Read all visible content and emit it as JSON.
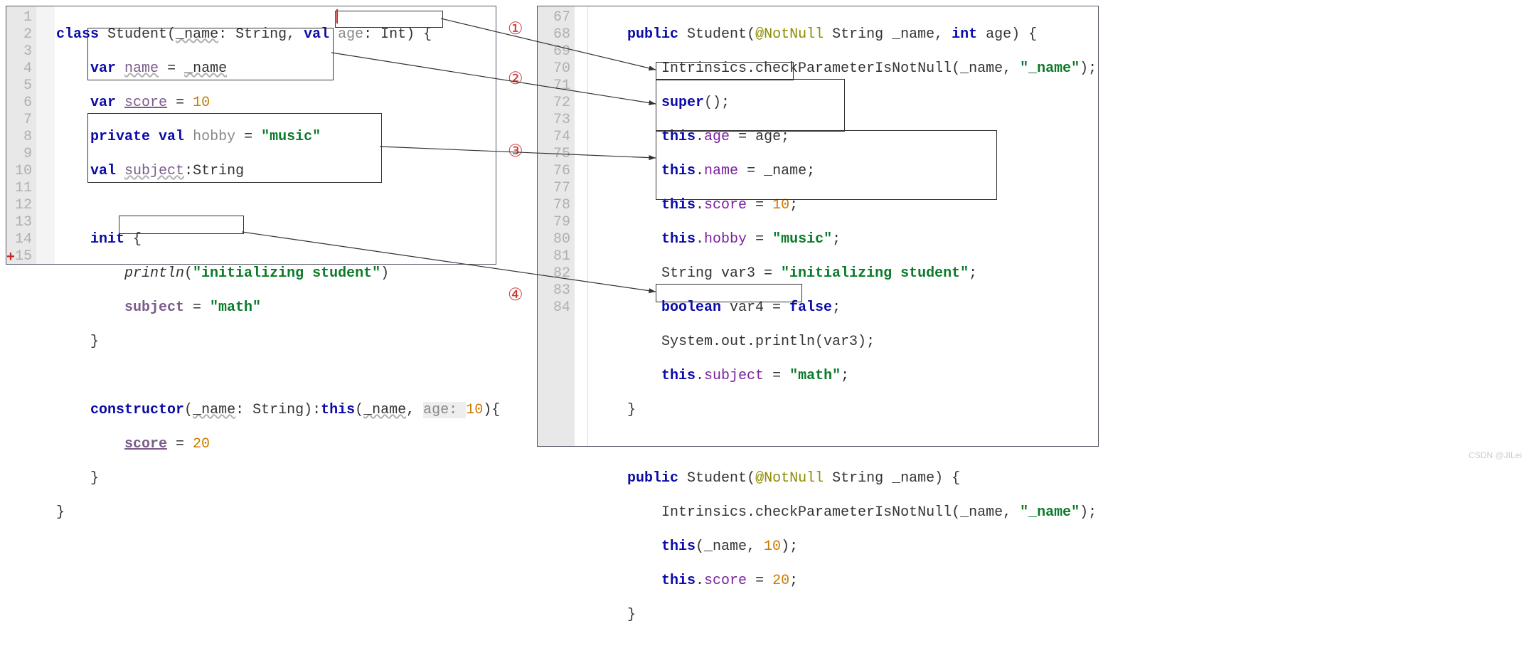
{
  "left": {
    "lines": [
      "1",
      "2",
      "3",
      "4",
      "5",
      "6",
      "7",
      "8",
      "9",
      "10",
      "11",
      "12",
      "13",
      "14",
      "15"
    ],
    "l1": {
      "kw1": "class",
      "name": "Student",
      "p": "(",
      "u": "_name",
      "t1": ": String, ",
      "kw2": "val",
      "sp": " ",
      "age": "age",
      "t2": ": Int) {"
    },
    "l2": {
      "kw": "var",
      "sp": " ",
      "name": "name",
      "eq": " = ",
      "u": "_name"
    },
    "l3": {
      "kw": "var",
      "sp": " ",
      "score": "score",
      "eq": " = ",
      "num": "10"
    },
    "l4": {
      "kw": "private val",
      "sp": " ",
      "hobby": "hobby",
      "eq": " = ",
      "str": "\"music\""
    },
    "l5": {
      "kw": "val",
      "sp": " ",
      "subj": "subject",
      "t": ":String"
    },
    "l7": {
      "kw": "init",
      "br": " {"
    },
    "l8": {
      "fn": "println",
      "p": "(",
      "str": "\"initializing student\"",
      "cp": ")"
    },
    "l9": {
      "subj": "subject",
      "eq": " = ",
      "str": "\"math\""
    },
    "l10": {
      "br": "}"
    },
    "l12": {
      "kw": "constructor",
      "p": "(",
      "u": "_name",
      "t1": ": String):",
      "kw2": "this",
      "p2": "(",
      "u2": "_name",
      "c": ", ",
      "hint": "age: ",
      "num": "10",
      "cp": "){"
    },
    "l13": {
      "score": "score",
      "eq": " = ",
      "num": "20"
    },
    "l14": {
      "br": "}"
    },
    "l15": {
      "br": "}"
    }
  },
  "right": {
    "lines": [
      "67",
      "68",
      "69",
      "70",
      "71",
      "72",
      "73",
      "74",
      "75",
      "76",
      "77",
      "78",
      "79",
      "80",
      "81",
      "82",
      "83",
      "84"
    ],
    "l67": {
      "kw": "public",
      "sp": " ",
      "name": "Student",
      "p": "(",
      "ann": "@NotNull",
      "t1": " String _name, ",
      "kw2": "int",
      "t2": " age) {"
    },
    "l68": {
      "t": "Intrinsics.checkParameterIsNotNull(_name, ",
      "str": "\"_name\"",
      "cp": ");"
    },
    "l69": {
      "kw": "super",
      "t": "();"
    },
    "l70": {
      "kw": "this",
      "d": ".",
      "age": "age",
      "eq": " = ",
      "v": "age;"
    },
    "l71": {
      "kw": "this",
      "d": ".",
      "name": "name",
      "eq": " = ",
      "v": "_name;"
    },
    "l72": {
      "kw": "this",
      "d": ".",
      "score": "score",
      "eq": " = ",
      "num": "10",
      "sc": ";"
    },
    "l73": {
      "kw": "this",
      "d": ".",
      "hobby": "hobby",
      "eq": " = ",
      "str": "\"music\"",
      "sc": ";"
    },
    "l74": {
      "t1": "String var3 = ",
      "str": "\"initializing student\"",
      "sc": ";"
    },
    "l75": {
      "kw": "boolean",
      "t": " var4 = ",
      "kw2": "false",
      "sc": ";"
    },
    "l76": {
      "t": "System.out.println(var3);"
    },
    "l77": {
      "kw": "this",
      "d": ".",
      "subj": "subject",
      "eq": " = ",
      "str": "\"math\"",
      "sc": ";"
    },
    "l78": {
      "br": "}"
    },
    "l80": {
      "kw": "public",
      "sp": " ",
      "name": "Student",
      "p": "(",
      "ann": "@NotNull",
      "t": " String _name) {"
    },
    "l81": {
      "t": "Intrinsics.checkParameterIsNotNull(_name, ",
      "str": "\"_name\"",
      "cp": ");"
    },
    "l82": {
      "kw": "this",
      "p": "(_name, ",
      "num": "10",
      "cp": ");"
    },
    "l83": {
      "kw": "this",
      "d": ".",
      "score": "score",
      "eq": " = ",
      "num": "20",
      "sc": ";"
    },
    "l84": {
      "br": "}"
    }
  },
  "annotations": {
    "a1": "①",
    "a2": "②",
    "a3": "③",
    "a4": "④"
  },
  "watermark": "CSDN @JILei"
}
